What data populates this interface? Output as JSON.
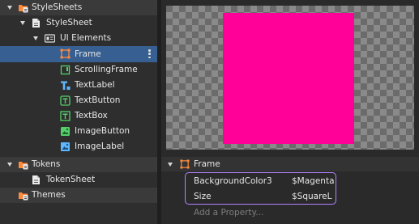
{
  "explorer": {
    "items": [
      {
        "label": "StyleSheets",
        "icon": "stylesheets-folder-icon"
      },
      {
        "label": "StyleSheet",
        "icon": "stylesheet-icon"
      },
      {
        "label": "UI Elements",
        "icon": "ui-elements-icon"
      },
      {
        "label": "Frame",
        "icon": "frame-icon"
      },
      {
        "label": "ScrollingFrame",
        "icon": "scrolling-frame-icon"
      },
      {
        "label": "TextLabel",
        "icon": "text-label-icon"
      },
      {
        "label": "TextButton",
        "icon": "text-button-icon"
      },
      {
        "label": "TextBox",
        "icon": "text-box-icon"
      },
      {
        "label": "ImageButton",
        "icon": "image-button-icon"
      },
      {
        "label": "ImageLabel",
        "icon": "image-label-icon"
      },
      {
        "label": "Tokens",
        "icon": "tokens-folder-icon"
      },
      {
        "label": "TokenSheet",
        "icon": "tokensheet-icon"
      },
      {
        "label": "Themes",
        "icon": "themes-folder-icon"
      }
    ]
  },
  "preview": {
    "frame_color": "#ff0099"
  },
  "properties": {
    "header": "Frame",
    "rows": [
      {
        "name": "BackgroundColor3",
        "value": "$Magenta"
      },
      {
        "name": "Size",
        "value": "$SquareL"
      }
    ],
    "add_placeholder": "Add a Property..."
  },
  "colors": {
    "selection": "#375f91",
    "highlight_border": "#b384ff",
    "frame_icon": "#ff8a3d"
  }
}
